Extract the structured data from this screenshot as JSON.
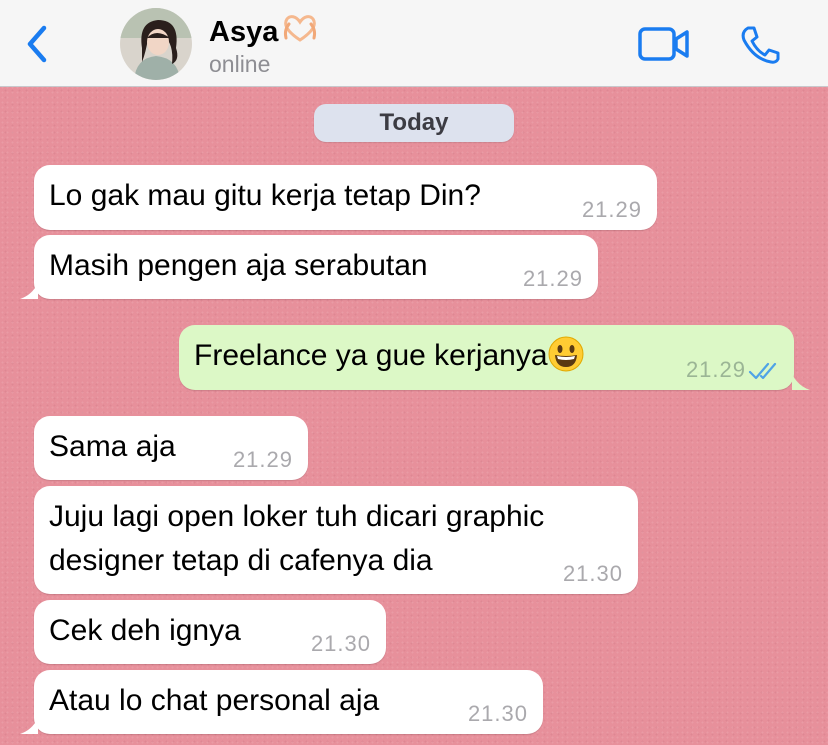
{
  "header": {
    "back_icon": "chevron-left-icon",
    "contact_name": "Asya",
    "name_emoji": "heart-hands-icon",
    "status": "online",
    "video_icon": "video-camera-icon",
    "call_icon": "phone-icon"
  },
  "chat": {
    "date_label": "Today",
    "messages": [
      {
        "direction": "incoming",
        "text": "Lo gak mau gitu kerja tetap Din?",
        "time": "21.29"
      },
      {
        "direction": "incoming",
        "text": "Masih pengen aja serabutan",
        "time": "21.29"
      },
      {
        "direction": "outgoing",
        "text": "Freelance ya gue kerjanya",
        "emoji": "grinning-face-icon",
        "time": "21.29",
        "status": "read",
        "status_icon": "double-check-icon"
      },
      {
        "direction": "incoming",
        "text": "Sama aja",
        "time": "21.29"
      },
      {
        "direction": "incoming",
        "text_lines": [
          "Juju lagi open loker tuh dicari graphic",
          "designer tetap di cafenya dia"
        ],
        "time": "21.30"
      },
      {
        "direction": "incoming",
        "text": "Cek deh ignya",
        "time": "21.30"
      },
      {
        "direction": "incoming",
        "text": "Atau lo chat personal aja",
        "time": "21.30"
      }
    ]
  },
  "colors": {
    "wallpaper": "#e7909b",
    "incoming_bubble": "#ffffff",
    "outgoing_bubble": "#dcf8c6",
    "accent": "#1a7cf0",
    "read_ticks": "#4fa3e6"
  }
}
